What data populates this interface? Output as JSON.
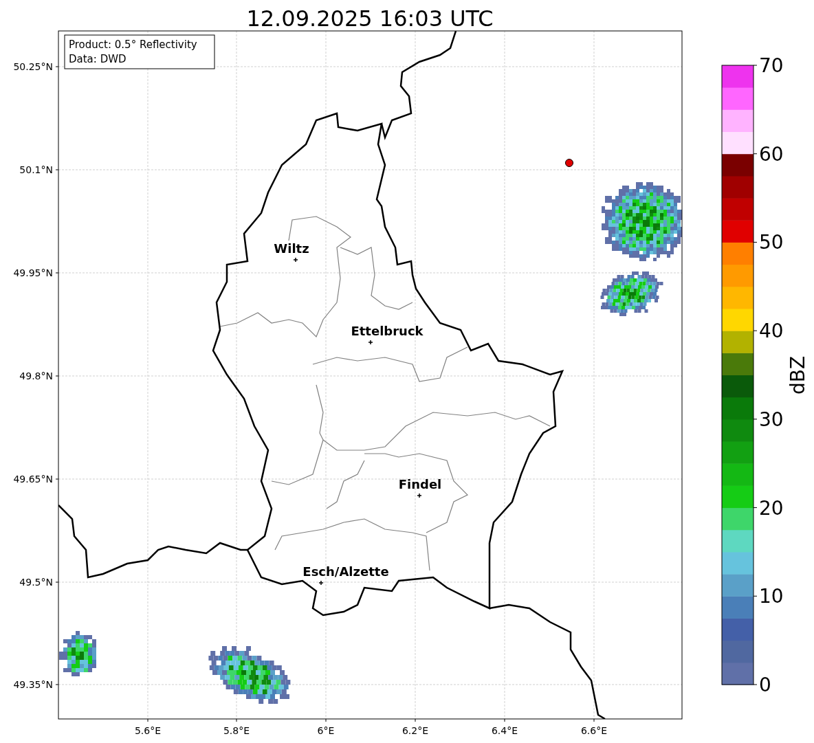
{
  "title": "12.09.2025 16:03 UTC",
  "info_box": [
    "Product: 0.5° Reflectivity",
    "Data: DWD"
  ],
  "y_ticks": [
    "50.25°N",
    "50.1°N",
    "49.95°N",
    "49.8°N",
    "49.65°N",
    "49.5°N",
    "49.35°N"
  ],
  "x_ticks": [
    "5.6°E",
    "5.8°E",
    "6°E",
    "6.2°E",
    "6.4°E",
    "6.6°E"
  ],
  "cities": [
    {
      "name": "Wiltz"
    },
    {
      "name": "Ettelbruck"
    },
    {
      "name": "Findel"
    },
    {
      "name": "Esch/Alzette"
    }
  ],
  "colorbar": {
    "label": "dBZ",
    "ticks": [
      "70",
      "60",
      "50",
      "40",
      "30",
      "20",
      "10",
      "0"
    ],
    "bands": [
      {
        "color": "#6070a8"
      },
      {
        "color": "#5068a0"
      },
      {
        "color": "#4460a8"
      },
      {
        "color": "#4a7fb8"
      },
      {
        "color": "#5aa0c8"
      },
      {
        "color": "#66c3dd"
      },
      {
        "color": "#5ed8c0"
      },
      {
        "color": "#3ed66a"
      },
      {
        "color": "#15cc15"
      },
      {
        "color": "#14b814"
      },
      {
        "color": "#12a012"
      },
      {
        "color": "#0f8a0f"
      },
      {
        "color": "#0a7a0a"
      },
      {
        "color": "#0a5a0a"
      },
      {
        "color": "#4a7a0a"
      },
      {
        "color": "#b2b200"
      },
      {
        "color": "#ffd700"
      },
      {
        "color": "#ffb700"
      },
      {
        "color": "#ff9a00"
      },
      {
        "color": "#ff7f00"
      },
      {
        "color": "#e00000"
      },
      {
        "color": "#c00000"
      },
      {
        "color": "#a00000"
      },
      {
        "color": "#7a0000"
      },
      {
        "color": "#ffe0ff"
      },
      {
        "color": "#ffb3ff"
      },
      {
        "color": "#ff66ff"
      },
      {
        "color": "#ee33ee"
      }
    ]
  }
}
